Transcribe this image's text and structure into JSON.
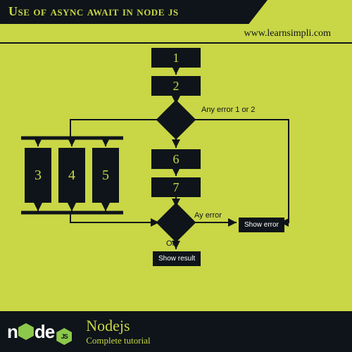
{
  "header": {
    "title": "Use of async await in node js",
    "website": "www.learnsimpli.com"
  },
  "nodes": {
    "n1": "1",
    "n2": "2",
    "n3": "3",
    "n4": "4",
    "n5": "5",
    "n6": "6",
    "n7": "7"
  },
  "labels": {
    "any_error": "Any error 1 or 2",
    "ay_error": "Ay error",
    "ok": "OK",
    "show_error": "Show error",
    "show_result": "Show result"
  },
  "footer": {
    "logo_text_before": "n",
    "logo_text_after": "de",
    "hex_label": "JS",
    "title": "Nodejs",
    "subtitle": "Complete tutorial"
  }
}
